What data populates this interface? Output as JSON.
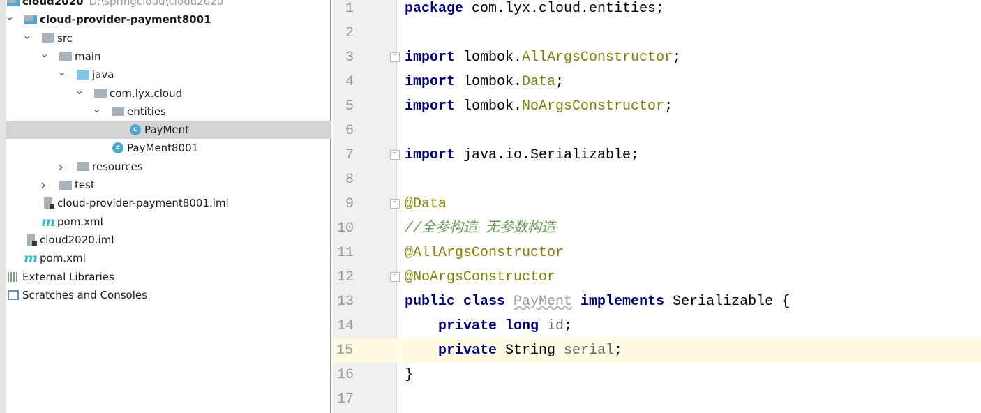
{
  "project_tree": [
    {
      "label": "cloud2020",
      "path": "D:\\springcloud\\cloud2020",
      "level": 1,
      "expanded": true,
      "icon": "module-icon",
      "bold": true
    },
    {
      "label": "cloud-provider-payment8001",
      "level": 2,
      "expanded": true,
      "icon": "module-icon",
      "bold": true
    },
    {
      "label": "src",
      "level": 3,
      "expanded": true,
      "icon": "folder-icon"
    },
    {
      "label": "main",
      "level": 4,
      "expanded": true,
      "icon": "folder-icon"
    },
    {
      "label": "java",
      "level": 5,
      "expanded": true,
      "icon": "source-folder-icon"
    },
    {
      "label": "com.lyx.cloud",
      "level": 6,
      "expanded": true,
      "icon": "package-icon"
    },
    {
      "label": "entities",
      "level": 7,
      "expanded": true,
      "icon": "package-icon"
    },
    {
      "label": "PayMent",
      "level": 8,
      "icon": "class-icon",
      "selected": true
    },
    {
      "label": "PayMent8001",
      "level": 7,
      "icon": "spring-boot-class-icon"
    },
    {
      "label": "resources",
      "level": 5,
      "expanded": false,
      "icon": "resources-folder-icon"
    },
    {
      "label": "test",
      "level": 4,
      "expanded": false,
      "icon": "folder-icon"
    },
    {
      "label": "cloud-provider-payment8001.iml",
      "level": 3,
      "icon": "iml-file-icon"
    },
    {
      "label": "pom.xml",
      "level": 3,
      "icon": "maven-icon"
    },
    {
      "label": "cloud2020.iml",
      "level": 2,
      "icon": "iml-file-icon"
    },
    {
      "label": "pom.xml",
      "level": 2,
      "icon": "maven-icon"
    },
    {
      "label": "External Libraries",
      "level": 1,
      "expanded": false,
      "icon": "libraries-icon"
    },
    {
      "label": "Scratches and Consoles",
      "level": 1,
      "expanded": false,
      "icon": "scratches-icon"
    }
  ],
  "editor": {
    "current_line": 15,
    "lines": [
      [
        [
          "kw",
          "package"
        ],
        [
          "pl",
          " com.lyx.cloud.entities;"
        ]
      ],
      [],
      [
        [
          "kw",
          "import"
        ],
        [
          "pl",
          " lombok."
        ],
        [
          "ann",
          "AllArgsConstructor"
        ],
        [
          "pl",
          ";"
        ]
      ],
      [
        [
          "kw",
          "import"
        ],
        [
          "pl",
          " lombok."
        ],
        [
          "ann",
          "Data"
        ],
        [
          "pl",
          ";"
        ]
      ],
      [
        [
          "kw",
          "import"
        ],
        [
          "pl",
          " lombok."
        ],
        [
          "ann",
          "NoArgsConstructor"
        ],
        [
          "pl",
          ";"
        ]
      ],
      [],
      [
        [
          "kw",
          "import"
        ],
        [
          "pl",
          " java.io.Serializable;"
        ]
      ],
      [],
      [
        [
          "ann",
          "@Data"
        ]
      ],
      [
        [
          "cm",
          "//全参构造 无参数构造"
        ]
      ],
      [
        [
          "ann",
          "@AllArgsConstructor"
        ]
      ],
      [
        [
          "ann",
          "@NoArgsConstructor"
        ]
      ],
      [
        [
          "kw",
          "public class "
        ],
        [
          "unusedw",
          "PayMent"
        ],
        [
          "kw",
          " implements "
        ],
        [
          "pl",
          "Serializable {"
        ]
      ],
      [
        [
          "pl",
          "    "
        ],
        [
          "kw",
          "private long "
        ],
        [
          "fld",
          "id"
        ],
        [
          "pl",
          ";"
        ]
      ],
      [
        [
          "pl",
          "    "
        ],
        [
          "kw",
          "private "
        ],
        [
          "pl",
          "String "
        ],
        [
          "fld",
          "serial"
        ],
        [
          "pl",
          ";"
        ]
      ],
      [
        [
          "pl",
          "}"
        ]
      ],
      []
    ],
    "fold_lines": [
      3,
      7,
      9,
      12
    ]
  }
}
